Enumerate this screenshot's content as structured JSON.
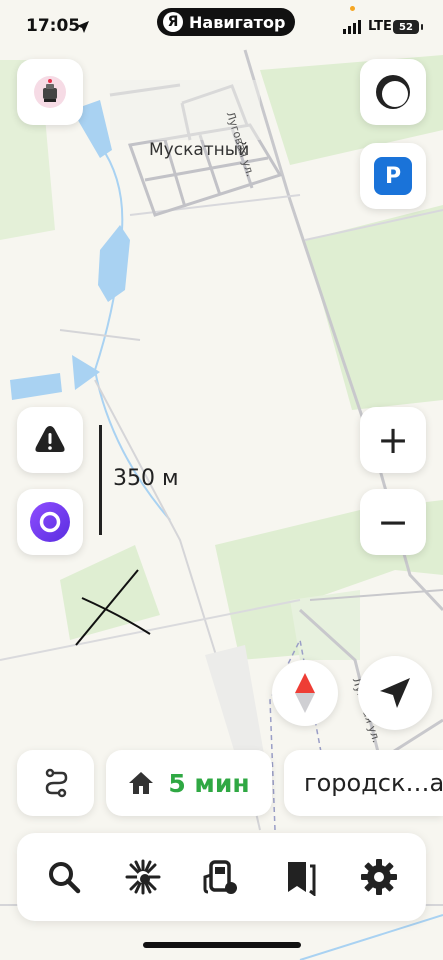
{
  "status_bar": {
    "time": "17:05",
    "network": "LTE",
    "battery": "52"
  },
  "app": {
    "logo_letter": "Я",
    "name": "Навигатор"
  },
  "map": {
    "place_label": "Мускатный",
    "street_label_1": "Луговая ул.",
    "street_label_2": "Луговая ул.",
    "scale_label": "350 м",
    "colors": {
      "land": "#f7f6f0",
      "green": "#dfeed2",
      "water": "#a9d2f2",
      "road": "#c9c9cc"
    }
  },
  "controls": {
    "left_top_icon": "robot-vacuum-icon",
    "alert_icon": "warning-icon",
    "alice_icon": "alice-voice-assistant-icon",
    "layers_icon": "circle-layers-icon",
    "parking_label": "P",
    "zoom_in_label": "+",
    "zoom_out_label": "−",
    "compass_icon": "compass-icon",
    "locate_icon": "location-arrow-icon"
  },
  "bottom": {
    "route_icon": "route-icon",
    "home_icon": "home-icon",
    "eta": "5 мин",
    "destination": "городск…а",
    "eta_color": "#2fa843"
  },
  "toolbar": {
    "items": [
      "search-icon",
      "sparkle-icon",
      "gas-station-icon",
      "bookmarks-icon",
      "settings-icon"
    ]
  }
}
